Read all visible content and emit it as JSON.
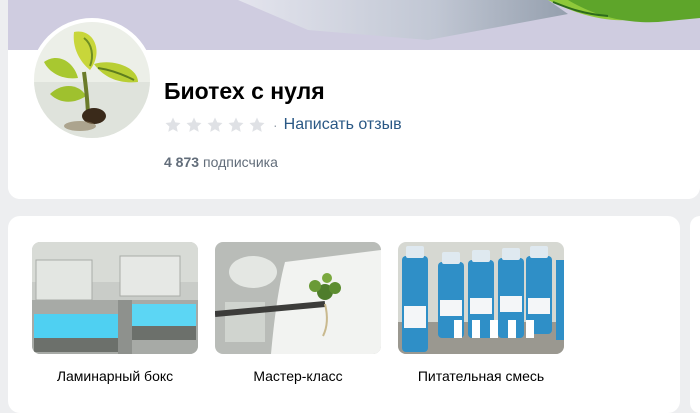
{
  "group": {
    "title": "Биотех с нуля",
    "rating_stars": 0,
    "rating_max": 5,
    "write_review": "Написать отзыв",
    "separator": "·",
    "subscribers_count": "4 873",
    "subscribers_label": "подписчика"
  },
  "products": [
    {
      "caption": "Ламинарный бокс",
      "image_icon": "laminar-box-photo"
    },
    {
      "caption": "Мастер-класс",
      "image_icon": "plant-tweezers-photo"
    },
    {
      "caption": "Питательная смесь",
      "image_icon": "nutrient-bottles-photo"
    }
  ],
  "colors": {
    "link": "#2a5885",
    "muted": "#626d7a",
    "background": "#edeef0",
    "star_empty": "#dfe1e5"
  }
}
